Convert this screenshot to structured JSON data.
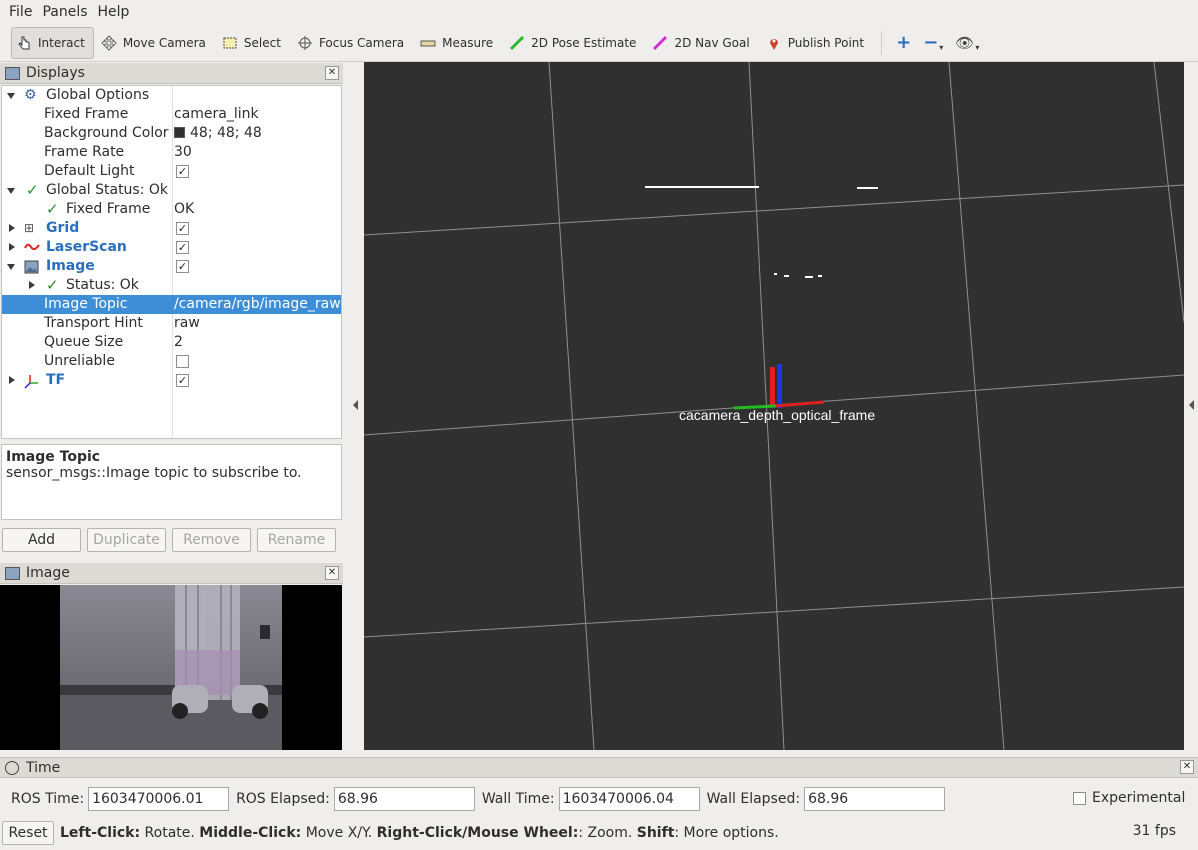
{
  "menu": [
    "File",
    "Panels",
    "Help"
  ],
  "toolbar": {
    "tools": [
      "Interact",
      "Move Camera",
      "Select",
      "Focus Camera",
      "Measure",
      "2D Pose Estimate",
      "2D Nav Goal",
      "Publish Point"
    ]
  },
  "displays": {
    "title": "Displays",
    "global_options": "Global Options",
    "fixed_frame_label": "Fixed Frame",
    "fixed_frame_value": "camera_link",
    "bg_color_label": "Background Color",
    "bg_color_value": "48; 48; 48",
    "frame_rate_label": "Frame Rate",
    "frame_rate_value": "30",
    "default_light_label": "Default Light",
    "global_status": "Global Status: Ok",
    "gs_fixed_frame": "Fixed Frame",
    "gs_fixed_frame_value": "OK",
    "grid": "Grid",
    "laserscan": "LaserScan",
    "image": "Image",
    "image_status": "Status: Ok",
    "image_topic_label": "Image Topic",
    "image_topic_value": "/camera/rgb/image_raw",
    "transport_hint_label": "Transport Hint",
    "transport_hint_value": "raw",
    "queue_size_label": "Queue Size",
    "queue_size_value": "2",
    "unreliable_label": "Unreliable",
    "tf": "TF"
  },
  "description": {
    "title": "Image Topic",
    "text": "sensor_msgs::Image topic to subscribe to."
  },
  "buttons": {
    "add": "Add",
    "duplicate": "Duplicate",
    "remove": "Remove",
    "rename": "Rename"
  },
  "image_panel": {
    "title": "Image"
  },
  "viewport": {
    "frame_label": "cacamera_depth_optical_frame"
  },
  "time": {
    "title": "Time",
    "ros_time_label": "ROS Time:",
    "ros_time_value": "1603470006.01",
    "ros_elapsed_label": "ROS Elapsed:",
    "ros_elapsed_value": "68.96",
    "wall_time_label": "Wall Time:",
    "wall_time_value": "1603470006.04",
    "wall_elapsed_label": "Wall Elapsed:",
    "wall_elapsed_value": "68.96",
    "experimental_label": "Experimental"
  },
  "status": {
    "reset": "Reset",
    "left_click": "Left-Click:",
    "left_click_desc": " Rotate. ",
    "middle_click": "Middle-Click:",
    "middle_click_desc": " Move X/Y. ",
    "right_click": "Right-Click/Mouse Wheel:",
    "right_click_desc": ": Zoom. ",
    "shift": "Shift",
    "shift_desc": ": More options.",
    "fps": "31 fps"
  },
  "colors": {
    "selection": "#3d8ed6",
    "viewport_bg": "#303030",
    "accent_blue": "#2a6fbd"
  }
}
